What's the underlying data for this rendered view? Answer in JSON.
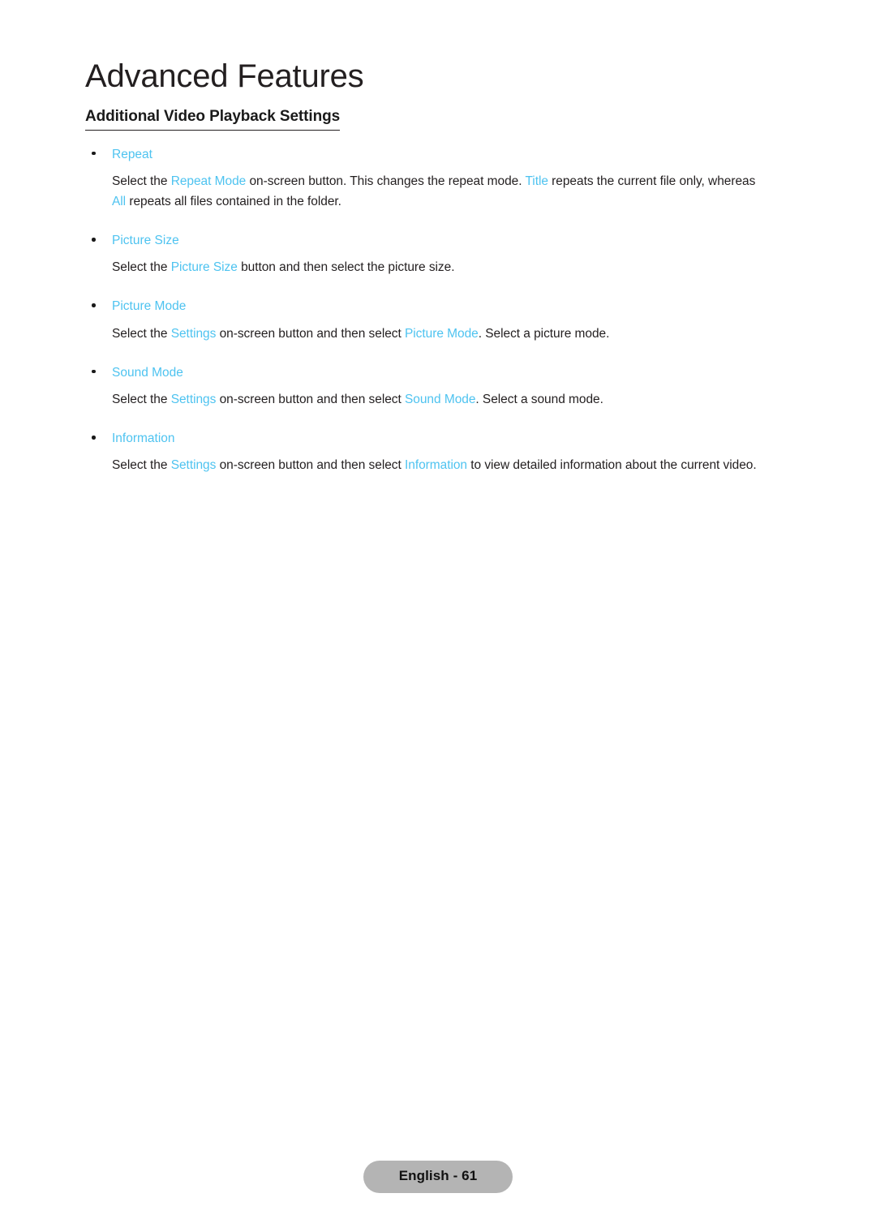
{
  "document": {
    "chapter_title": "Advanced Features",
    "section_heading": "Additional Video Playback Settings"
  },
  "sections": [
    {
      "label": "Repeat",
      "paragraph": {
        "part1": "Select the ",
        "term1": "Repeat Mode",
        "part2": " on-screen button. This changes the repeat mode. ",
        "term2": "Title",
        "part3": " repeats the current file only, whereas ",
        "term3": "All",
        "part4": " repeats all files contained in the folder."
      }
    },
    {
      "label": "Picture Size",
      "paragraph": {
        "part1": "Select the ",
        "term1": "Picture Size",
        "part2": " button and then select the picture size."
      }
    },
    {
      "label": "Picture Mode",
      "paragraph": {
        "part1": "Select the ",
        "term1": "Settings",
        "part2": " on-screen button and then select ",
        "term2": "Picture Mode",
        "part3": ". Select a picture mode."
      }
    },
    {
      "label": "Sound Mode",
      "paragraph": {
        "part1": "Select the ",
        "term1": "Settings",
        "part2": " on-screen button and then select ",
        "term2": "Sound Mode",
        "part3": ". Select a sound mode."
      }
    },
    {
      "label": "Information",
      "paragraph": {
        "part1": "Select the ",
        "term1": "Settings",
        "part2": " on-screen button and then select ",
        "term2": "Information",
        "part3": " to view detailed information about the current video."
      }
    }
  ],
  "footer": {
    "page_label": "English - 61"
  },
  "colors": {
    "highlight": "#4ec3f0",
    "text": "#231f20",
    "pill_background": "#b4b4b4"
  }
}
